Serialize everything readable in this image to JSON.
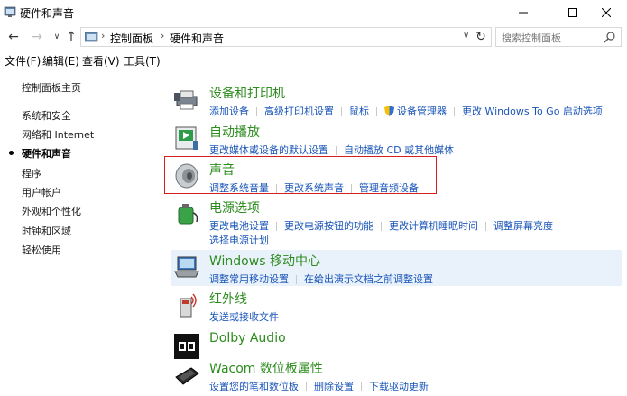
{
  "window": {
    "title": "硬件和声音"
  },
  "address": {
    "crumbs": [
      "控制面板",
      "硬件和声音"
    ],
    "separator": "›",
    "dropdown": "∨",
    "search_placeholder": "搜索控制面板"
  },
  "nav": {
    "back": "←",
    "forward": "→",
    "recent": "∨",
    "up": "↑",
    "refresh": "↻"
  },
  "menubar": [
    "文件(F)",
    "编辑(E)",
    "查看(V)",
    "工具(T)"
  ],
  "sidebar": {
    "items": [
      {
        "label": "控制面板主页"
      },
      {
        "label": "系统和安全"
      },
      {
        "label": "网络和 Internet"
      },
      {
        "label": "硬件和声音"
      },
      {
        "label": "程序"
      },
      {
        "label": "用户帐户"
      },
      {
        "label": "外观和个性化"
      },
      {
        "label": "时钟和区域"
      },
      {
        "label": "轻松使用"
      }
    ]
  },
  "categories": [
    {
      "title": "设备和打印机",
      "links": [
        "添加设备",
        "高级打印机设置",
        "鼠标",
        "设备管理器",
        "更改 Windows To Go 启动选项"
      ]
    },
    {
      "title": "自动播放",
      "links": [
        "更改媒体或设备的默认设置",
        "自动播放 CD 或其他媒体"
      ]
    },
    {
      "title": "声音",
      "links": [
        "调整系统音量",
        "更改系统声音",
        "管理音频设备"
      ]
    },
    {
      "title": "电源选项",
      "links": [
        "更改电池设置",
        "更改电源按钮的功能",
        "更改计算机睡眠时间",
        "调整屏幕亮度"
      ],
      "links2": [
        "选择电源计划"
      ]
    },
    {
      "title": "Windows 移动中心",
      "links": [
        "调整常用移动设置",
        "在给出演示文档之前调整设置"
      ]
    },
    {
      "title": "红外线",
      "links": [
        "发送或接收文件"
      ]
    },
    {
      "title": "Dolby Audio",
      "links": []
    },
    {
      "title": "Wacom 数位板属性",
      "links": [
        "设置您的笔和数位板",
        "删除设置",
        "下载驱动更新"
      ]
    }
  ],
  "colors": {
    "category_title": "#2d8c1e",
    "link": "#1a55b8",
    "highlight": "#d61e1e"
  }
}
